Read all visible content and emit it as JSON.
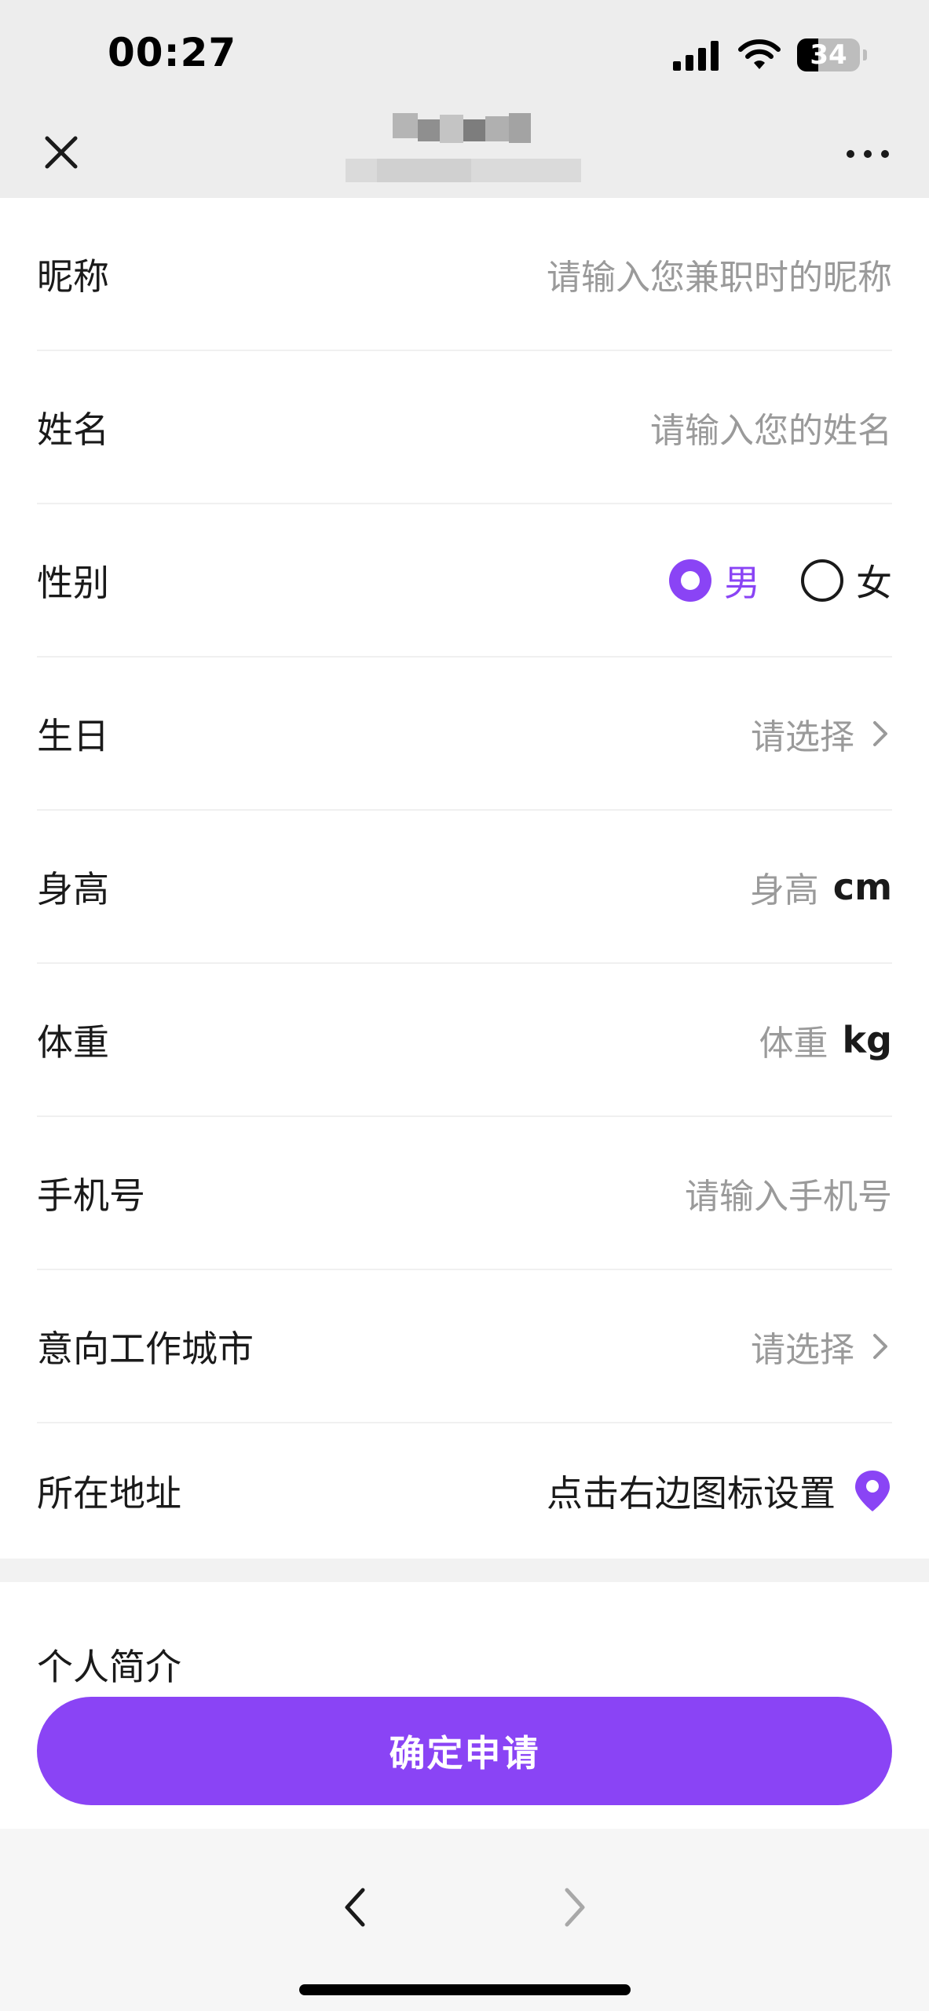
{
  "status_bar": {
    "time": "00:27",
    "battery_level": "34",
    "icons": [
      "cellular-signal-icon",
      "wifi-icon",
      "battery-icon"
    ]
  },
  "nav": {
    "icons": [
      "close-icon",
      "more-icon"
    ]
  },
  "form": {
    "nickname": {
      "label": "昵称",
      "placeholder": "请输入您兼职时的昵称"
    },
    "name": {
      "label": "姓名",
      "placeholder": "请输入您的姓名"
    },
    "gender": {
      "label": "性别",
      "options": [
        {
          "label": "男",
          "selected": true
        },
        {
          "label": "女",
          "selected": false
        }
      ]
    },
    "birthday": {
      "label": "生日",
      "placeholder": "请选择"
    },
    "height": {
      "label": "身高",
      "placeholder": "身高",
      "unit": "cm"
    },
    "weight": {
      "label": "体重",
      "placeholder": "体重",
      "unit": "kg"
    },
    "phone": {
      "label": "手机号",
      "placeholder": "请输入手机号"
    },
    "city": {
      "label": "意向工作城市",
      "placeholder": "请选择"
    },
    "address": {
      "label": "所在地址",
      "hint": "点击右边图标设置"
    }
  },
  "bio": {
    "label": "个人简介"
  },
  "submit": {
    "label": "确定申请"
  },
  "colors": {
    "accent": "#8a44f5",
    "placeholder": "#9a9a9a",
    "background": "#ededed"
  }
}
